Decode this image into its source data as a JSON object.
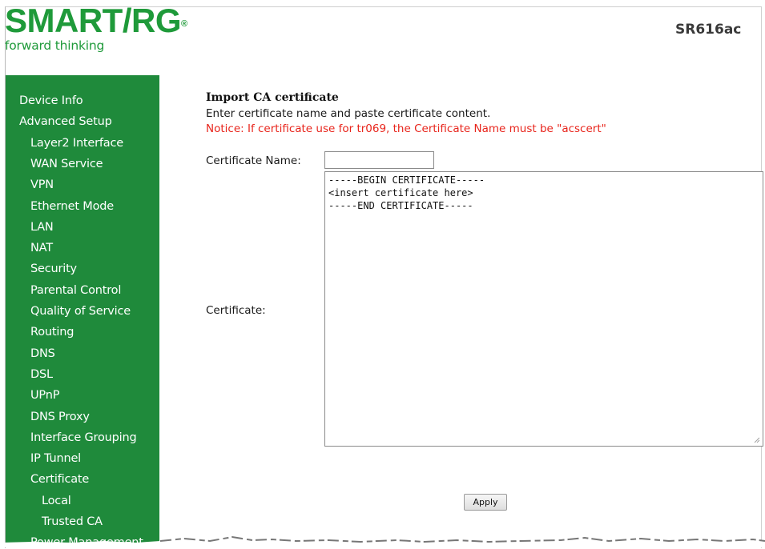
{
  "brand": {
    "name": "SMART/RG",
    "registered": "®",
    "tagline": "forward thinking",
    "color": "#1f9a3a"
  },
  "model": "SR616ac",
  "sidebar": {
    "background": "#1f8a3b",
    "items": [
      {
        "label": "Device Info",
        "level": 1
      },
      {
        "label": "Advanced Setup",
        "level": 1
      },
      {
        "label": "Layer2 Interface",
        "level": 2
      },
      {
        "label": "WAN Service",
        "level": 2
      },
      {
        "label": "VPN",
        "level": 2
      },
      {
        "label": "Ethernet Mode",
        "level": 2
      },
      {
        "label": "LAN",
        "level": 2
      },
      {
        "label": "NAT",
        "level": 2
      },
      {
        "label": "Security",
        "level": 2
      },
      {
        "label": "Parental Control",
        "level": 2
      },
      {
        "label": "Quality of Service",
        "level": 2
      },
      {
        "label": "Routing",
        "level": 2
      },
      {
        "label": "DNS",
        "level": 2
      },
      {
        "label": "DSL",
        "level": 2
      },
      {
        "label": "UPnP",
        "level": 2
      },
      {
        "label": "DNS Proxy",
        "level": 2
      },
      {
        "label": "Interface Grouping",
        "level": 2
      },
      {
        "label": "IP Tunnel",
        "level": 2
      },
      {
        "label": "Certificate",
        "level": 2
      },
      {
        "label": "Local",
        "level": 3
      },
      {
        "label": "Trusted CA",
        "level": 3
      },
      {
        "label": "Power Management",
        "level": 2
      }
    ]
  },
  "main": {
    "title": "Import CA certificate",
    "description": "Enter certificate name and paste certificate content.",
    "notice": "Notice: If certificate use for tr069, the Certificate Name must be \"acscert\"",
    "notice_color": "#e8251c",
    "cert_name_label": "Certificate Name:",
    "cert_name_value": "",
    "certificate_label": "Certificate:",
    "certificate_value": "-----BEGIN CERTIFICATE-----\n<insert certificate here>\n-----END CERTIFICATE-----",
    "apply_label": "Apply"
  }
}
